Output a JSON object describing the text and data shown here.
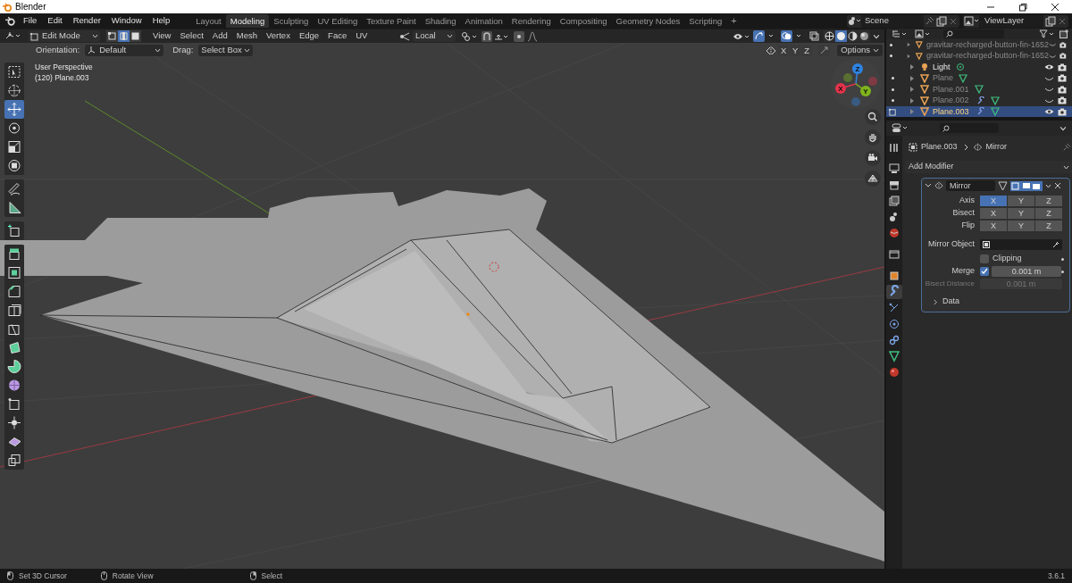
{
  "window": {
    "title": "Blender"
  },
  "menu": [
    "File",
    "Edit",
    "Render",
    "Window",
    "Help"
  ],
  "workspaces": [
    {
      "label": "Layout",
      "selected": false
    },
    {
      "label": "Modeling",
      "selected": true
    },
    {
      "label": "Sculpting",
      "selected": false
    },
    {
      "label": "UV Editing",
      "selected": false
    },
    {
      "label": "Texture Paint",
      "selected": false
    },
    {
      "label": "Shading",
      "selected": false
    },
    {
      "label": "Animation",
      "selected": false
    },
    {
      "label": "Rendering",
      "selected": false
    },
    {
      "label": "Compositing",
      "selected": false
    },
    {
      "label": "Geometry Nodes",
      "selected": false
    },
    {
      "label": "Scripting",
      "selected": false
    }
  ],
  "add_workspace": "+",
  "scene": "Scene",
  "view_layer": "ViewLayer",
  "header": {
    "mode": "Edit Mode",
    "select_modes": [
      {
        "kind": "vertex",
        "selected": false
      },
      {
        "kind": "edge",
        "selected": true
      },
      {
        "kind": "face",
        "selected": false
      }
    ],
    "menus": [
      "View",
      "Select",
      "Add",
      "Mesh",
      "Vertex",
      "Edge",
      "Face",
      "UV"
    ],
    "pivot": "Local",
    "shading": [
      {
        "kind": "wireframe",
        "selected": false
      },
      {
        "kind": "solid",
        "selected": true
      },
      {
        "kind": "material",
        "selected": false
      },
      {
        "kind": "rendered",
        "selected": false
      }
    ]
  },
  "tool_settings": {
    "orientation_label": "Orientation:",
    "orientation": "Default",
    "drag_label": "Drag:",
    "drag": "Select Box",
    "mirror_axes": [
      {
        "label": "X",
        "selected": false
      },
      {
        "label": "Y",
        "selected": false
      },
      {
        "label": "Z",
        "selected": false
      }
    ],
    "options": "Options"
  },
  "viewport": {
    "view_name": "User Perspective",
    "object_info": "(120) Plane.003",
    "gizmo": [
      {
        "label": "Z",
        "color": "#2f83e3"
      },
      {
        "label": "X",
        "color": "#e3324b"
      },
      {
        "label": "Y",
        "color": "#80b51c"
      }
    ]
  },
  "toolbar": [
    {
      "tools": [
        {
          "kind": "select-box",
          "selected": false
        },
        {
          "kind": "cursor",
          "selected": false
        },
        {
          "kind": "move",
          "selected": true
        },
        {
          "kind": "rotate",
          "selected": false
        },
        {
          "kind": "scale",
          "selected": false
        },
        {
          "kind": "transform",
          "selected": false
        }
      ]
    },
    {
      "tools": [
        {
          "kind": "annotate",
          "selected": false
        },
        {
          "kind": "measure",
          "selected": false
        }
      ]
    },
    {
      "tools": [
        {
          "kind": "add-cube",
          "selected": false
        }
      ]
    },
    {
      "tools": [
        {
          "kind": "extrude",
          "selected": false
        },
        {
          "kind": "inset",
          "selected": false
        },
        {
          "kind": "bevel",
          "selected": false
        },
        {
          "kind": "loop-cut",
          "selected": false
        },
        {
          "kind": "knife",
          "selected": false
        },
        {
          "kind": "poly-build",
          "selected": false
        },
        {
          "kind": "spin",
          "selected": false
        },
        {
          "kind": "smooth",
          "selected": false
        },
        {
          "kind": "edge-slide",
          "selected": false
        },
        {
          "kind": "shrink",
          "selected": false
        },
        {
          "kind": "shear",
          "selected": false
        },
        {
          "kind": "rip",
          "selected": false
        }
      ]
    }
  ],
  "outliner": {
    "items": [
      {
        "name": "gravitar-recharged-button-fin-1652",
        "kind": "mesh",
        "visible": false,
        "selected": false,
        "modifier": false,
        "data": false
      },
      {
        "name": "gravitar-recharged-button-fin-1652",
        "kind": "mesh",
        "visible": false,
        "selected": false,
        "modifier": false,
        "data": false
      },
      {
        "name": "Light",
        "kind": "light",
        "visible": true,
        "selected": false,
        "modifier": false,
        "data": true
      },
      {
        "name": "Plane",
        "kind": "mesh",
        "visible": false,
        "selected": false,
        "modifier": false,
        "data": true
      },
      {
        "name": "Plane.001",
        "kind": "mesh",
        "visible": false,
        "selected": false,
        "modifier": false,
        "data": true
      },
      {
        "name": "Plane.002",
        "kind": "mesh",
        "visible": false,
        "selected": false,
        "modifier": true,
        "data": true
      },
      {
        "name": "Plane.003",
        "kind": "mesh",
        "visible": true,
        "selected": true,
        "modifier": true,
        "data": true
      }
    ]
  },
  "properties": {
    "tabs": [
      {
        "kind": "tool",
        "selected": false
      },
      {
        "kind": "render",
        "selected": false
      },
      {
        "kind": "output",
        "selected": false
      },
      {
        "kind": "view-layer",
        "selected": false
      },
      {
        "kind": "scene",
        "selected": false
      },
      {
        "kind": "world",
        "selected": false
      },
      {
        "kind": "collection",
        "selected": false
      },
      {
        "kind": "object",
        "selected": false
      },
      {
        "kind": "modifiers",
        "selected": true
      },
      {
        "kind": "particles",
        "selected": false
      },
      {
        "kind": "physics",
        "selected": false
      },
      {
        "kind": "constraints",
        "selected": false
      },
      {
        "kind": "data",
        "selected": false
      },
      {
        "kind": "material",
        "selected": false
      }
    ],
    "breadcrumb": [
      "Plane.003",
      "Mirror"
    ],
    "add_modifier": "Add Modifier",
    "modifier": {
      "name": "Mirror",
      "expanded": true,
      "rows": [
        {
          "label": "Axis",
          "buttons": [
            {
              "label": "X",
              "selected": true
            },
            {
              "label": "Y",
              "selected": false
            },
            {
              "label": "Z",
              "selected": false
            }
          ]
        },
        {
          "label": "Bisect",
          "buttons": [
            {
              "label": "X",
              "selected": false
            },
            {
              "label": "Y",
              "selected": false
            },
            {
              "label": "Z",
              "selected": false
            }
          ]
        },
        {
          "label": "Flip",
          "buttons": [
            {
              "label": "X",
              "selected": false
            },
            {
              "label": "Y",
              "selected": false
            },
            {
              "label": "Z",
              "selected": false
            }
          ]
        }
      ],
      "mirror_object_label": "Mirror Object",
      "clipping": {
        "label": "Clipping",
        "checked": false
      },
      "merge": {
        "label": "Merge",
        "checked": true,
        "value": "0.001 m"
      },
      "bisect_distance": {
        "label": "Bisect Distance",
        "value": "0.001 m",
        "disabled": true
      },
      "data_panel": {
        "label": "Data",
        "expanded": false
      }
    }
  },
  "status_bar": {
    "hints": [
      "Set 3D Cursor",
      "Rotate View",
      "Select"
    ],
    "version": "3.6.1"
  }
}
